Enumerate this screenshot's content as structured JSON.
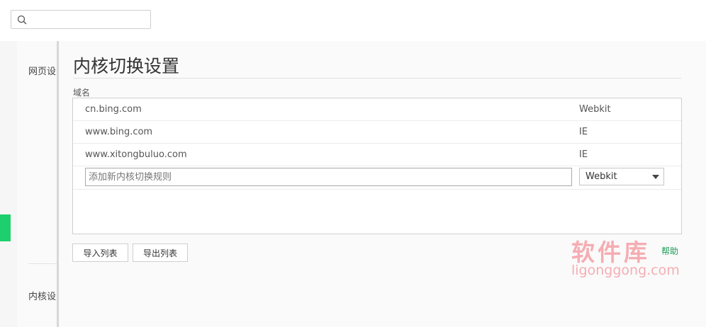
{
  "search": {
    "value": "",
    "placeholder": ""
  },
  "sidebar": {
    "web_settings_label": "网页设",
    "kernel_settings_label": "内核设"
  },
  "dialog": {
    "title": "内核切换设置",
    "domain_label": "域名",
    "rules": [
      {
        "domain": "cn.bing.com",
        "engine": "Webkit"
      },
      {
        "domain": "www.bing.com",
        "engine": "IE"
      },
      {
        "domain": "www.xitongbuluo.com",
        "engine": "IE"
      }
    ],
    "new_rule": {
      "value": "",
      "placeholder": "添加新内核切换规则",
      "engine_selected": "Webkit"
    },
    "import_label": "导入列表",
    "export_label": "导出列表",
    "help_label": "帮助"
  },
  "watermark": {
    "cn": "软件库",
    "en": "ligonggong.com"
  },
  "colors": {
    "accent_green": "#1ecf6e",
    "help_link": "#1a9b56",
    "watermark": "#f06e78"
  }
}
